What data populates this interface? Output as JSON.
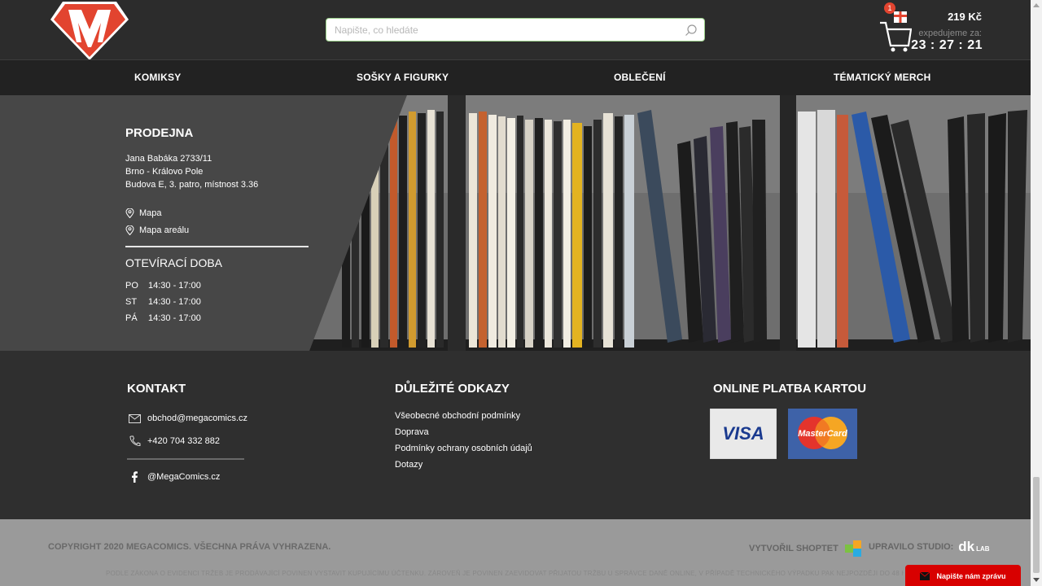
{
  "header": {
    "search_placeholder": "Napište, co hledáte",
    "cart_count": "1",
    "cart_price": "219 Kč",
    "ship_label": "expedujeme za:",
    "countdown": "23 : 27 : 21"
  },
  "nav": {
    "items": [
      {
        "label": "KOMIKSY"
      },
      {
        "label": "SOŠKY A FIGURKY"
      },
      {
        "label": "OBLEČENÍ"
      },
      {
        "label": "TÉMATICKÝ MERCH"
      }
    ]
  },
  "shop": {
    "title": "PRODEJNA",
    "address": [
      "Jana Babáka 2733/11",
      "Brno - Královo Pole",
      "Budova E, 3. patro, místnost 3.36"
    ],
    "map_links": [
      {
        "label": "Mapa",
        "icon": "map-pin-icon"
      },
      {
        "label": "Mapa areálu",
        "icon": "map-pin-icon"
      }
    ],
    "hours_title": "OTEVÍRACÍ DOBA",
    "hours": [
      {
        "day": "PO",
        "time": "14:30 - 17:00"
      },
      {
        "day": "ST",
        "time": "14:30 - 17:00"
      },
      {
        "day": "PÁ",
        "time": "14:30 - 17:00"
      }
    ]
  },
  "footer": {
    "contact_title": "KONTAKT",
    "email": "obchod@megacomics.cz",
    "phone": "+420 704 332 882",
    "facebook": "@MegaComics.cz",
    "links_title": "DŮLEŽITÉ ODKAZY",
    "links": [
      "Všeobecné obchodní podmínky",
      "Doprava",
      "Podmínky ochrany osobních údajů",
      "Dotazy"
    ],
    "payment_title": "ONLINE PLATBA KARTOU",
    "cards": [
      "VISA",
      "MasterCard"
    ]
  },
  "bottom": {
    "copyright": "COPYRIGHT 2020 MEGACOMICS. VŠECHNA PRÁVA VYHRAZENA.",
    "shoptet": "VYTVOŘIL SHOPTET",
    "studio": "UPRAVILO STUDIO:",
    "studio_logo": "dk",
    "studio_logo_small": "LAB",
    "legal": "PODLE ZÁKONA O EVIDENCI TRŽEB JE PRODÁVAJÍCÍ POVINEN VYSTAVIT KUPUJÍCÍMU ÚČTENKU. ZÁROVEŇ JE POVINEN ZAEVIDOVAT PŘIJATOU TRŽBU U SPRÁVCE DANĚ ONLINE, V PŘÍPADĚ TECHNICKÉHO VÝPADKU PAK NEJPOZDĚJI DO 48 H",
    "chat": "Napište nám zprávu"
  },
  "colors": {
    "accent": "#e2442f",
    "chat": "#d80000",
    "search_border": "#9bd08a"
  }
}
